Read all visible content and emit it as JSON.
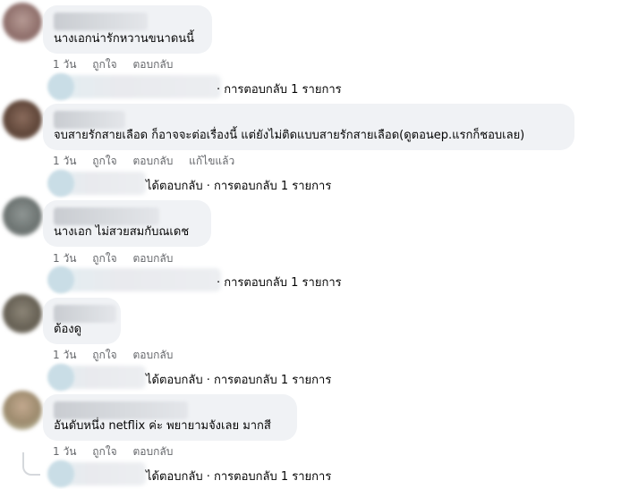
{
  "comments": [
    {
      "text": "นางเอกน่ารักหวานขนาดนนี้",
      "actions": [
        "1 วัน",
        "ถูกใจ",
        "ตอบกลับ"
      ],
      "reply_summary": "· การตอบกลับ 1 รายการ"
    },
    {
      "text": "จบสายรักสายเลือด ก็อาจจะต่อเรื่องนี้ แต่ยังไม่ติดแบบสายรักสายเลือด(ดูตอนep.แรกก็ชอบเลย)",
      "actions": [
        "1 วัน",
        "ถูกใจ",
        "ตอบกลับ",
        "แก้ไขแล้ว"
      ],
      "reply_summary": "ได้ตอบกลับ · การตอบกลับ 1 รายการ"
    },
    {
      "text": "นางเอก ไม่สวยสมกับณเดช",
      "actions": [
        "1 วัน",
        "ถูกใจ",
        "ตอบกลับ"
      ],
      "reply_summary": "· การตอบกลับ 1 รายการ"
    },
    {
      "text": "ต้องดู",
      "actions": [
        "1 วัน",
        "ถูกใจ",
        "ตอบกลับ"
      ],
      "reply_summary": "ได้ตอบกลับ · การตอบกลับ 1 รายการ"
    },
    {
      "text": "อันดับหนึ่ง netflix ค่ะ พยายามจังเลย มากสี",
      "actions": [
        "1 วัน",
        "ถูกใจ",
        "ตอบกลับ"
      ],
      "reply_summary": "ได้ตอบกลับ · การตอบกลับ 1 รายการ"
    }
  ]
}
